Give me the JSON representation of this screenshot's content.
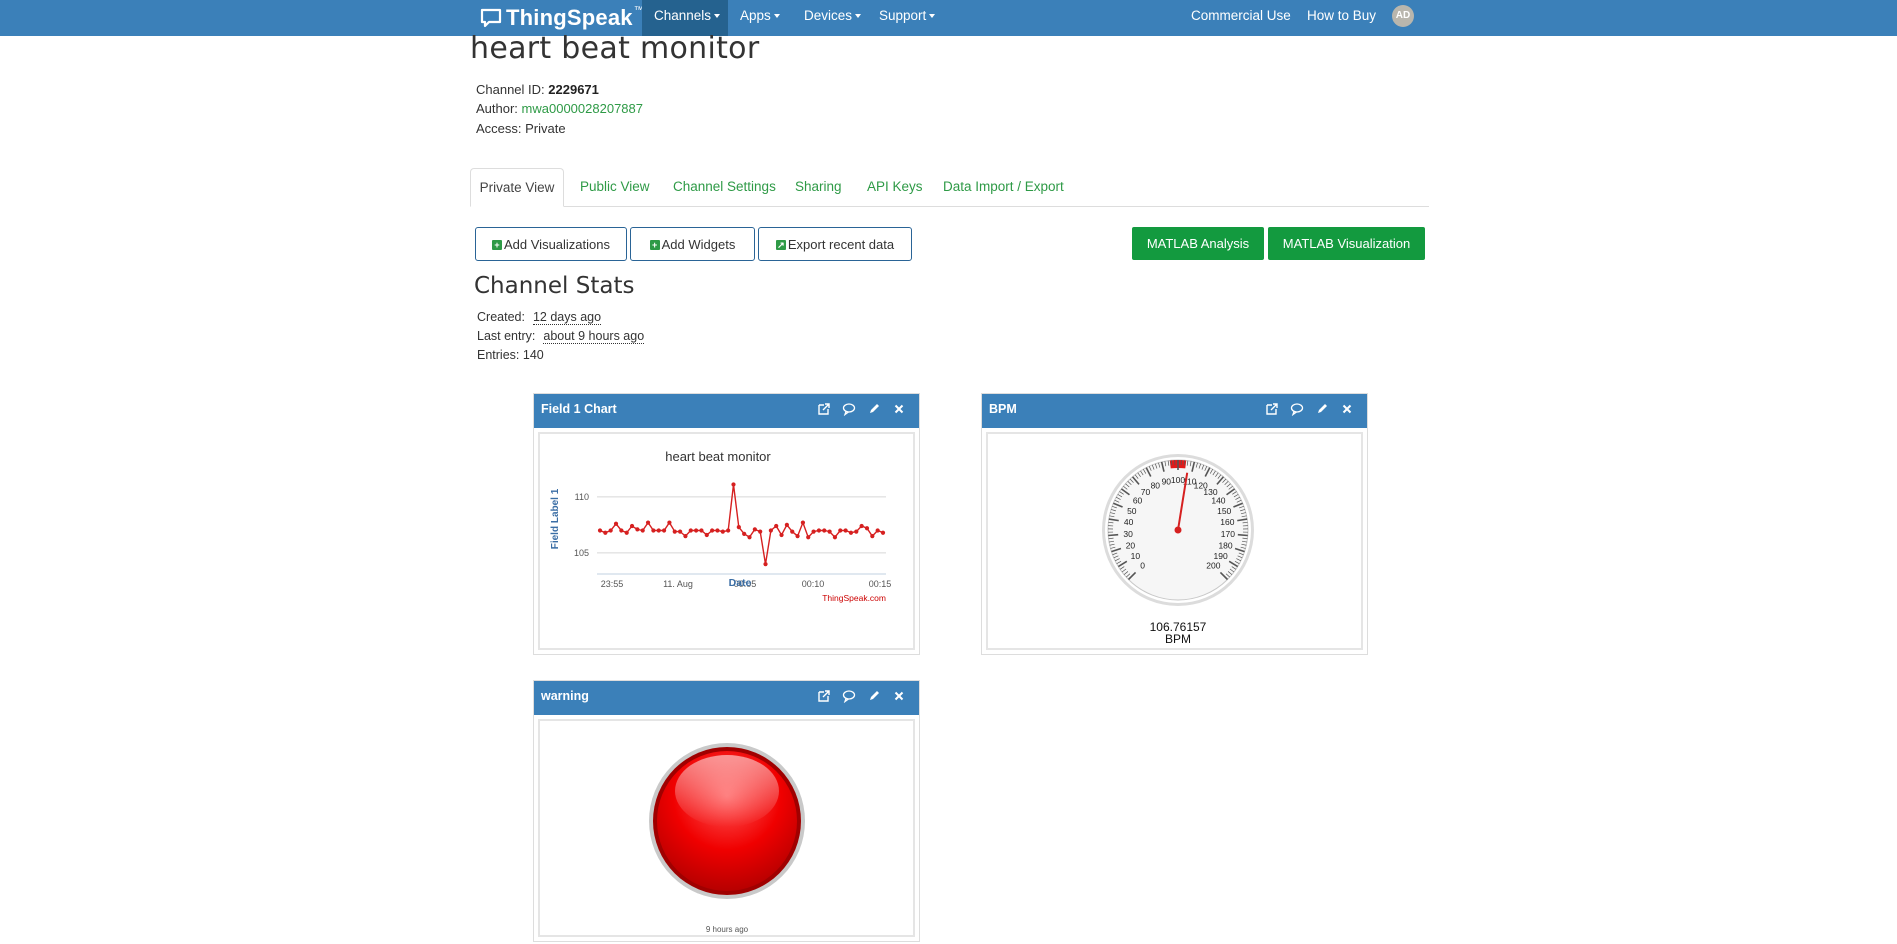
{
  "navbar": {
    "brand": "ThingSpeak",
    "brand_tm": "™",
    "items": [
      {
        "label": "Channels"
      },
      {
        "label": "Apps"
      },
      {
        "label": "Devices"
      },
      {
        "label": "Support"
      }
    ],
    "right_items": [
      {
        "label": "Commercial Use"
      },
      {
        "label": "How to Buy"
      }
    ],
    "avatar_initials": "AD"
  },
  "channel": {
    "title": "heart beat monitor",
    "id_label": "Channel ID:",
    "id_value": "2229671",
    "author_label": "Author:",
    "author_value": "mwa0000028207887",
    "access_label": "Access:",
    "access_value": "Private"
  },
  "tabs": [
    {
      "label": "Private View"
    },
    {
      "label": "Public View"
    },
    {
      "label": "Channel Settings"
    },
    {
      "label": "Sharing"
    },
    {
      "label": "API Keys"
    },
    {
      "label": "Data Import / Export"
    }
  ],
  "actions": {
    "add_visualizations": "Add Visualizations",
    "add_widgets": "Add Widgets",
    "export_recent": "Export recent data",
    "matlab_analysis": "MATLAB Analysis",
    "matlab_visualization": "MATLAB Visualization"
  },
  "stats": {
    "title": "Channel Stats",
    "created_label": "Created:",
    "created_value": "12 days ago",
    "last_entry_label": "Last entry:",
    "last_entry_value": "about 9 hours ago",
    "entries_label": "Entries:",
    "entries_value": "140"
  },
  "widgets": {
    "field1": {
      "title": "Field 1 Chart"
    },
    "bpm": {
      "title": "BPM",
      "value": "106.76157",
      "unit": "BPM"
    },
    "warning": {
      "title": "warning",
      "timestamp": "9 hours ago"
    }
  },
  "colors": {
    "navbar": "#3b80b9",
    "accent_green": "#139a3f",
    "series": "#d62020",
    "lamp": "#ee0000"
  },
  "icons": {
    "widget_actions": [
      "external-link-icon",
      "comment-icon",
      "pencil-icon",
      "close-icon"
    ]
  },
  "chart_data": [
    {
      "type": "line",
      "title": "heart beat monitor",
      "xlabel": "Date",
      "ylabel": "Field Label 1",
      "credit": "ThingSpeak.com",
      "x_ticks": [
        "23:55",
        "11. Aug",
        "00:05",
        "00:10",
        "00:15"
      ],
      "y_ticks": [
        "105",
        "110"
      ],
      "ylim": [
        103.3,
        111.5
      ],
      "series": [
        {
          "values": [
            107.0,
            106.8,
            107.0,
            107.6,
            107.0,
            106.8,
            107.4,
            107.1,
            107.0,
            107.7,
            107.0,
            107.0,
            107.0,
            107.7,
            106.9,
            106.9,
            106.5,
            107.0,
            107.0,
            107.0,
            106.6,
            107.0,
            107.0,
            106.9,
            107.0,
            111.1,
            107.3,
            106.7,
            106.4,
            107.1,
            106.9,
            104.0,
            107.0,
            107.4,
            106.6,
            107.5,
            106.9,
            106.5,
            107.7,
            106.4,
            106.9,
            107.0,
            107.0,
            106.9,
            106.4,
            107.0,
            107.0,
            106.8,
            106.9,
            107.4,
            107.2,
            106.5,
            107.0,
            106.8
          ]
        }
      ]
    },
    {
      "type": "gauge",
      "min": 0,
      "max": 200,
      "value": 106.76157,
      "tick_labels": [
        "0",
        "10",
        "20",
        "30",
        "40",
        "50",
        "60",
        "70",
        "80",
        "90",
        "100",
        "110",
        "120",
        "130",
        "140",
        "150",
        "160",
        "170",
        "180",
        "190",
        "200"
      ],
      "red_band": [
        95,
        105
      ]
    }
  ]
}
